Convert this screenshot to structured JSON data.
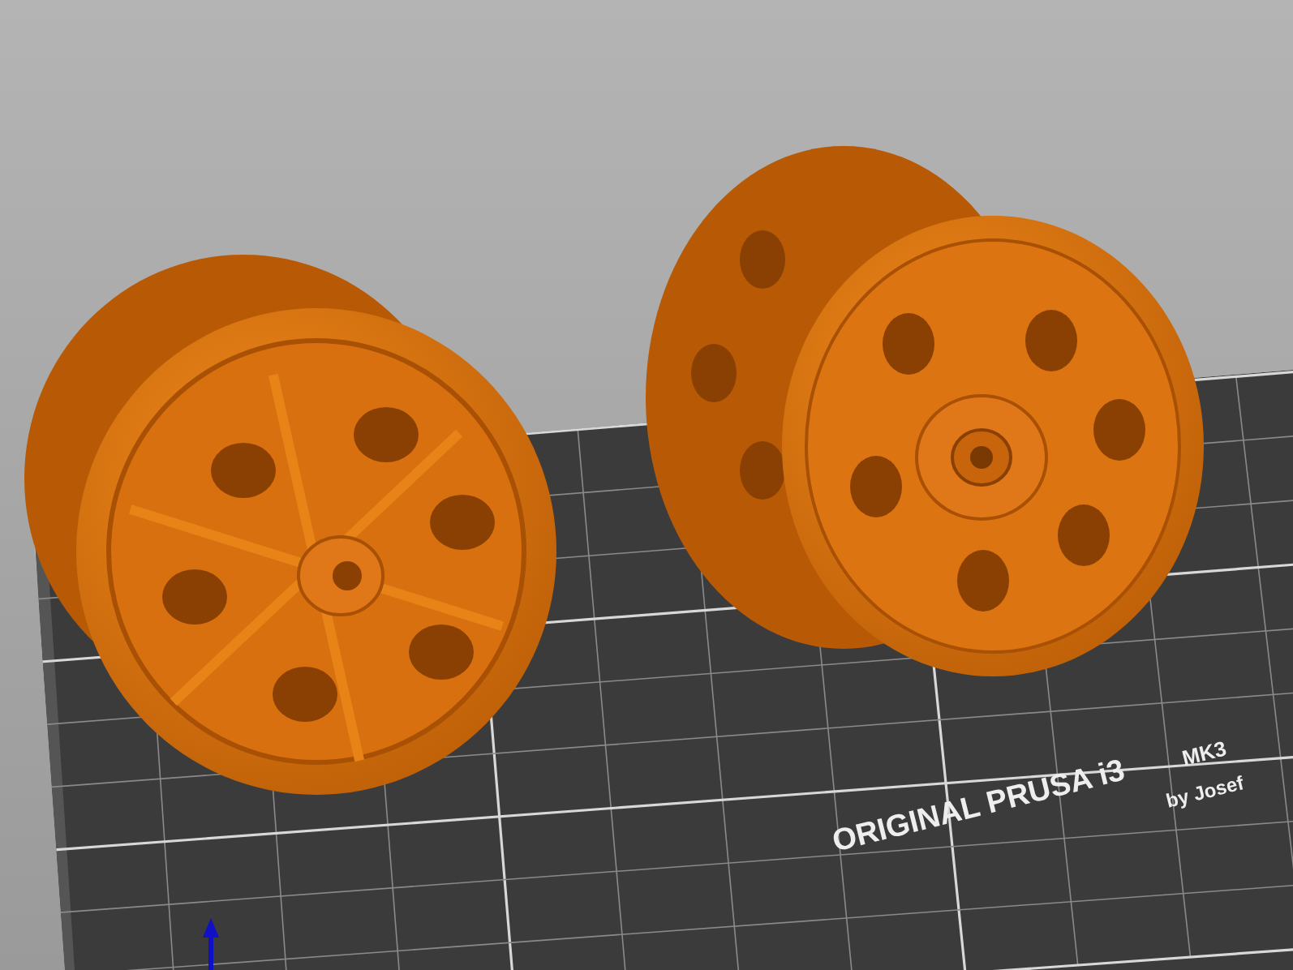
{
  "viewport": {
    "bed": {
      "label": "ORIGINAL PRUSA i3",
      "model": "MK3",
      "credit": "by Josef"
    }
  }
}
